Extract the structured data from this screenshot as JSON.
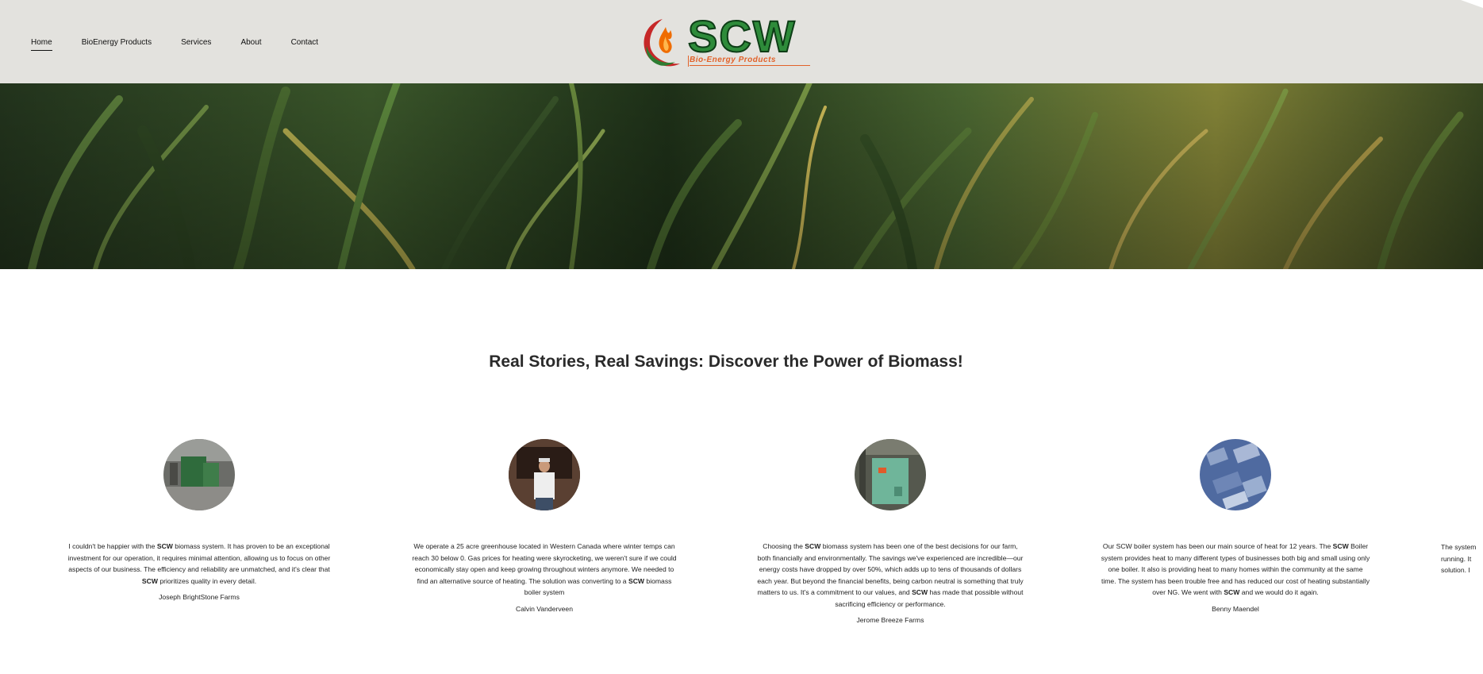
{
  "nav": {
    "items": [
      {
        "label": "Home",
        "active": true
      },
      {
        "label": "BioEnergy Products"
      },
      {
        "label": "Services"
      },
      {
        "label": "About"
      },
      {
        "label": "Contact"
      }
    ]
  },
  "logo": {
    "title": "SCW",
    "subtitle": "Bio-Energy Products"
  },
  "section": {
    "heading": "Real Stories, Real Savings: Discover the Power of Biomass!"
  },
  "testimonials": [
    {
      "segments": [
        "I couldn't be happier with the ",
        "SCW",
        " biomass system. It has proven to be an exceptional investment for our operation, it requires minimal attention, allowing us to focus on other aspects of our business. The efficiency and reliability are unmatched, and it's clear that ",
        "SCW",
        " prioritizes quality in every detail."
      ],
      "author": "Joseph BrightStone Farms"
    },
    {
      "segments": [
        "We operate a 25 acre greenhouse located in Western Canada where winter temps can reach 30 below 0. Gas prices for heating were skyrocketing, we weren't sure if we could economically stay open and keep growing throughout winters anymore. We needed to find an alternative source of heating. The solution was converting to a ",
        "SCW",
        " biomass boiler system"
      ],
      "author": "Calvin Vanderveen"
    },
    {
      "segments": [
        "Choosing the ",
        "SCW",
        " biomass system has been one of the best decisions for our farm, both financially and environmentally. The savings we've experienced are incredible—our energy costs have dropped by over 50%, which adds up to tens of thousands of dollars each year. But beyond the financial benefits, being carbon neutral is something that truly matters to us. It's a commitment to our values, and ",
        "SCW",
        " has made that possible without sacrificing efficiency or performance."
      ],
      "author": "Jerome Breeze Farms"
    },
    {
      "segments": [
        "Our SCW boiler system has been our main source of heat for 12 years. The ",
        "SCW",
        " Boiler system provides heat to many different types of businesses both big and small using only one boiler. It also is providing heat to many homes within the community at the same time. The system has been trouble free and has reduced our cost of heating substantially over NG. We went with ",
        "SCW",
        " and we would do it again."
      ],
      "author": "Benny Maendel"
    }
  ],
  "peek_lines": [
    "The system",
    "running. It",
    "solution. I"
  ],
  "colors": {
    "header_bg": "#e3e2de",
    "brand_green": "#2e8b3a",
    "brand_orange": "#e2622a"
  }
}
